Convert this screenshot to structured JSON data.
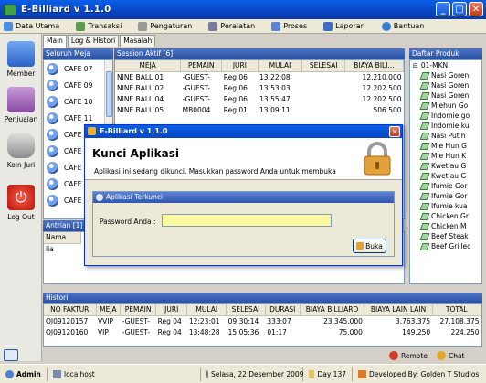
{
  "window": {
    "title": "E-Billiard v 1.1.0"
  },
  "menu": [
    {
      "label": "Data Utama",
      "icon": "data-utama-icon"
    },
    {
      "label": "Transaksi",
      "icon": "transaksi-icon"
    },
    {
      "label": "Pengaturan",
      "icon": "pengaturan-icon"
    },
    {
      "label": "Peralatan",
      "icon": "peralatan-icon"
    },
    {
      "label": "Proses",
      "icon": "proses-icon"
    },
    {
      "label": "Laporan",
      "icon": "laporan-icon"
    },
    {
      "label": "Bantuan",
      "icon": "bantuan-icon"
    }
  ],
  "sidebar": [
    {
      "label": "Member",
      "icon": "member-icon"
    },
    {
      "label": "Penjualan",
      "icon": "penjualan-icon"
    },
    {
      "label": "Koin Juri",
      "icon": "koin-juri-icon"
    },
    {
      "label": "Log Out",
      "icon": "power-icon"
    }
  ],
  "tabs": [
    "Main",
    "Log & Histori",
    "Masalah"
  ],
  "meja_panel": {
    "title": "Seluruh Meja",
    "items": [
      "CAFE 07",
      "CAFE 09",
      "CAFE 10",
      "CAFE 11",
      "CAFE 1",
      "CAFE 1",
      "CAFE 1",
      "CAFE 1",
      "CAFE 1"
    ]
  },
  "session": {
    "title": "Session Aktif [6]",
    "columns": [
      "MEJA",
      "PEMAIN",
      "JURI",
      "MULAI",
      "SELESAI",
      "BIAYA BILI..."
    ],
    "rows": [
      [
        "NINE BALL 01",
        "-GUEST-",
        "Reg 06",
        "13:22:08",
        "",
        "12.210.000"
      ],
      [
        "NINE BALL 02",
        "-GUEST-",
        "Reg 06",
        "13:53:03",
        "",
        "12.202.500"
      ],
      [
        "NINE BALL 04",
        "-GUEST-",
        "Reg 06",
        "13:55:47",
        "",
        "12.202.500"
      ],
      [
        "NINE BALL 05",
        "MB0004",
        "Reg 01",
        "13:09:11",
        "",
        "506.500"
      ]
    ]
  },
  "produk": {
    "title": "Daftar Produk",
    "root": "01-MKN",
    "items": [
      "Nasi Goren",
      "Nasi Goren",
      "Nasi Goren",
      "Miehun Go",
      "Indomie go",
      "Indomie ku",
      "Nasi Putih",
      "Mie Hun G",
      "Mie Hun K",
      "Kwetiau G",
      "Kwetiau G",
      "Ifumie Gor",
      "Ifumie Gor",
      "Ifumie kua",
      "Chicken Gr",
      "Chicken M",
      "Beef Steak",
      "Beef Grillec"
    ]
  },
  "antrian": {
    "title": "Antrian [1]",
    "columns": [
      "Nama"
    ],
    "rows": [
      [
        "lia"
      ]
    ]
  },
  "histori": {
    "title": "Histori",
    "columns": [
      "NO FAKTUR",
      "MEJA",
      "PEMAIN",
      "JURI",
      "MULAI",
      "SELESAI",
      "DURASI",
      "BIAYA BILLIARD",
      "BIAYA LAIN LAIN",
      "TOTAL"
    ],
    "rows": [
      [
        "OJ09120157",
        "VVIP",
        "-GUEST-",
        "Reg 04",
        "12:23:01",
        "09:30:14",
        "333:07",
        "23.345.000",
        "3.763.375",
        "27.108.375"
      ],
      [
        "OJ09120160",
        "VIP",
        "-GUEST-",
        "Reg 04",
        "13:48:28",
        "15:05:36",
        "01:17",
        "75.000",
        "149.250",
        "224.250"
      ]
    ]
  },
  "dialog": {
    "title": "E-Billiard v 1.1.0",
    "heading": "Kunci Aplikasi",
    "subtitle": "Aplikasi ini sedang dikunci. Masukkan password Anda untuk membuka",
    "frame_title": "Aplikasi Terkunci",
    "password_label": "Password Anda :",
    "password_value": "",
    "unlock_label": "Buka"
  },
  "bottom_links": [
    {
      "label": "Remote",
      "icon": "remote-icon"
    },
    {
      "label": "Chat",
      "icon": "chat-icon"
    }
  ],
  "status": {
    "user": "Admin",
    "host": "localhost",
    "date": "Selasa, 22 Desember 2009",
    "day": "Day 137",
    "developer": "Developed By: Golden T Studios"
  }
}
